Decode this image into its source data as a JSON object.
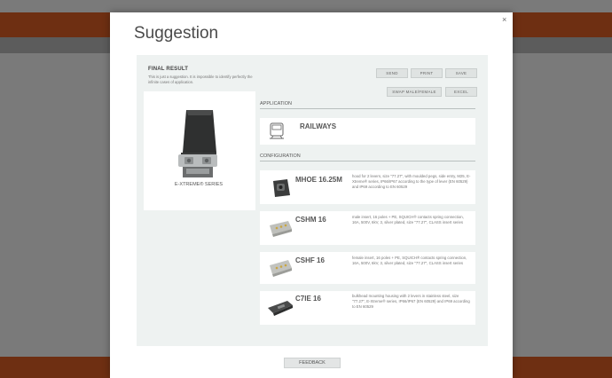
{
  "modal": {
    "title": "Suggestion",
    "close_glyph": "×"
  },
  "result": {
    "heading": "FINAL RESULT",
    "description": "This is just a suggestion. It is impossible to identify perfectly the infinite cases of application."
  },
  "actions": {
    "send": "SEND",
    "print": "PRINT",
    "save": "SAVE",
    "swap": "SWAP MALE/FEMALE",
    "excel": "EXCEL"
  },
  "series": {
    "label": "E-XTREME® SERIES",
    "icon": "connector-housing-image"
  },
  "application": {
    "heading": "APPLICATION",
    "name": "RAILWAYS",
    "icon": "train-icon"
  },
  "configuration": {
    "heading": "CONFIGURATION",
    "items": [
      {
        "name": "MHOE 16.25M",
        "description": "hood for 2 levers, size \"77.27\", with moulded pegs, side entry, M25, E-Xtreme® series, IP66/IP67 according to the type of lever (EN 60529) and IP69 according to EN 60529",
        "icon": "hood-image"
      },
      {
        "name": "CSHM 16",
        "description": "male insert, 16 poles + PE, SQUICH® contacts spring connection, 16A, 500V, 6kV, 3, silver plated, size \"77.27\", CLASS insert series",
        "icon": "male-insert-image"
      },
      {
        "name": "CSHF 16",
        "description": "female insert, 16 poles + PE, SQUICH® contacts spring connection, 16A, 500V, 6kV, 3, silver plated, size \"77.27\", CLASS insert series",
        "icon": "female-insert-image"
      },
      {
        "name": "C7IE 16",
        "description": "bulkhead mounting housing with 2 levers in stainless steel, size \"77.27\", E-Xtreme® series, IP66/IP67 (EN 60529) and IP69 according to EN 60529",
        "icon": "bulkhead-housing-image"
      }
    ]
  },
  "footer": {
    "feedback": "FEEDBACK"
  },
  "colors": {
    "header_bar": "#6e2f12",
    "overlay": "#7a7a7a",
    "panel": "#eef2f1"
  }
}
